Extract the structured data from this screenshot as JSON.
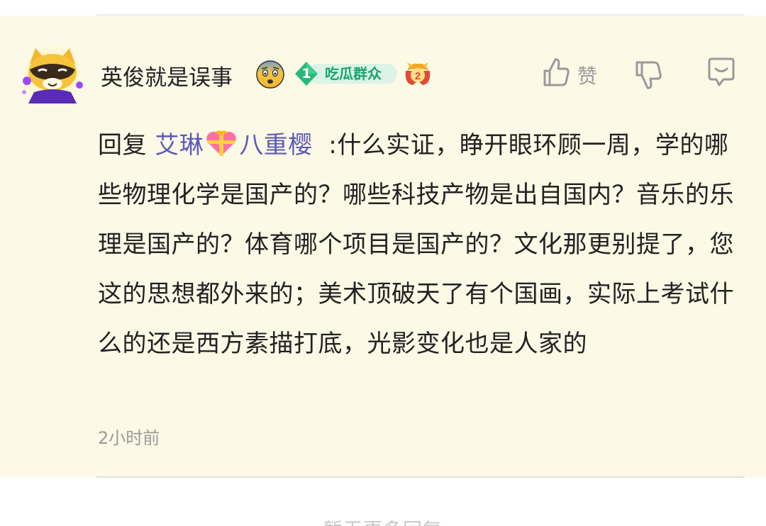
{
  "comment": {
    "username": "英俊就是误事",
    "username_emoji": "fearful-face-icon",
    "badge": {
      "level": "1",
      "name": "吃瓜群众",
      "color": "#18a46a"
    },
    "gift_badge": {
      "number": "2"
    },
    "actions": {
      "like_label": "赞"
    },
    "reply_prefix": "回复",
    "mention_part1": "艾琳",
    "mention_part2": "八重樱",
    "body_colon": "  :",
    "body_text": "什么实证，睁开眼环顾一周，学的哪些物理化学是国产的？哪些科技产物是出自国内？音乐的乐理是国产的？体育哪个项目是国产的？文化那更别提了，您这的思想都外来的；美术顶破天了有个国画，实际上考试什么的还是西方素描打底，光影变化也是人家的",
    "timestamp": "2小时前"
  },
  "footer": {
    "no_more_text": "暂无更多回复"
  },
  "colors": {
    "card_bg": "#fcf9e6",
    "mention": "#5c5ab8",
    "muted": "#9a9a9a"
  }
}
